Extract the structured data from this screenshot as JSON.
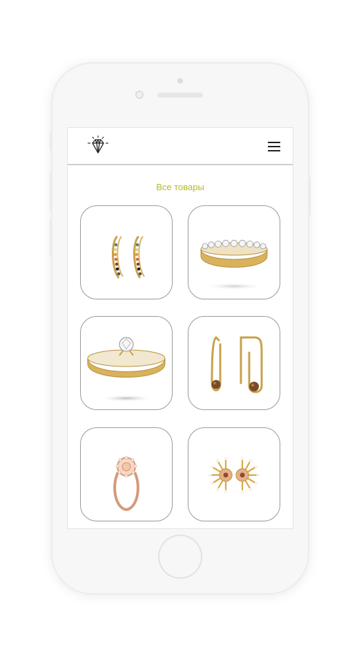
{
  "nav": {
    "logo_icon": "diamond-logo-icon",
    "menu_icon": "hamburger-menu-icon"
  },
  "catalog": {
    "heading": "Все товары",
    "heading_color": "#b5bb1f",
    "products": [
      {
        "icon": "hoop-earrings-icon"
      },
      {
        "icon": "eternity-ring-icon"
      },
      {
        "icon": "solitaire-ring-icon"
      },
      {
        "icon": "pin-earrings-icon"
      },
      {
        "icon": "rose-gold-halo-ring-icon"
      },
      {
        "icon": "sunburst-studs-icon"
      }
    ]
  },
  "colors": {
    "gold": "#c9a14a",
    "rose_gold": "#d59a7a",
    "accent": "#b5bb1f"
  }
}
